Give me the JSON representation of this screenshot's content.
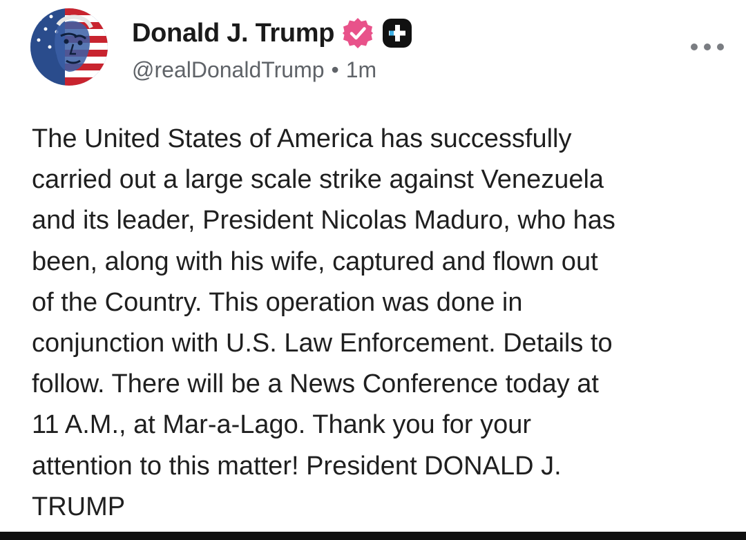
{
  "post": {
    "author": {
      "display_name": "Donald J. Trump",
      "handle": "@realDonaldTrump",
      "separator": "•",
      "time_ago": "1m",
      "verified_badge_icon": "verified-check-icon",
      "plus_badge_icon": "plus-badge-icon",
      "avatar_icon": "avatar-image"
    },
    "menu_icon": "more-options-icon",
    "body_lines": [
      "The United States of America has successfully",
      "carried out a large scale strike against Venezuela",
      "and its leader, President Nicolas Maduro, who has",
      "been, along with his wife, captured and flown out",
      "of the Country. This operation was done in",
      "conjunction with U.S. Law Enforcement. Details to",
      "follow. There will be a News Conference today at",
      "11 A.M., at Mar-a-Lago. Thank you for your",
      "attention to this matter! President DONALD J.",
      "TRUMP"
    ],
    "colors": {
      "verified": "#e8528a",
      "plus_badge": "#111111",
      "text": "#1f1f1f",
      "meta_text": "#5f6368"
    }
  }
}
